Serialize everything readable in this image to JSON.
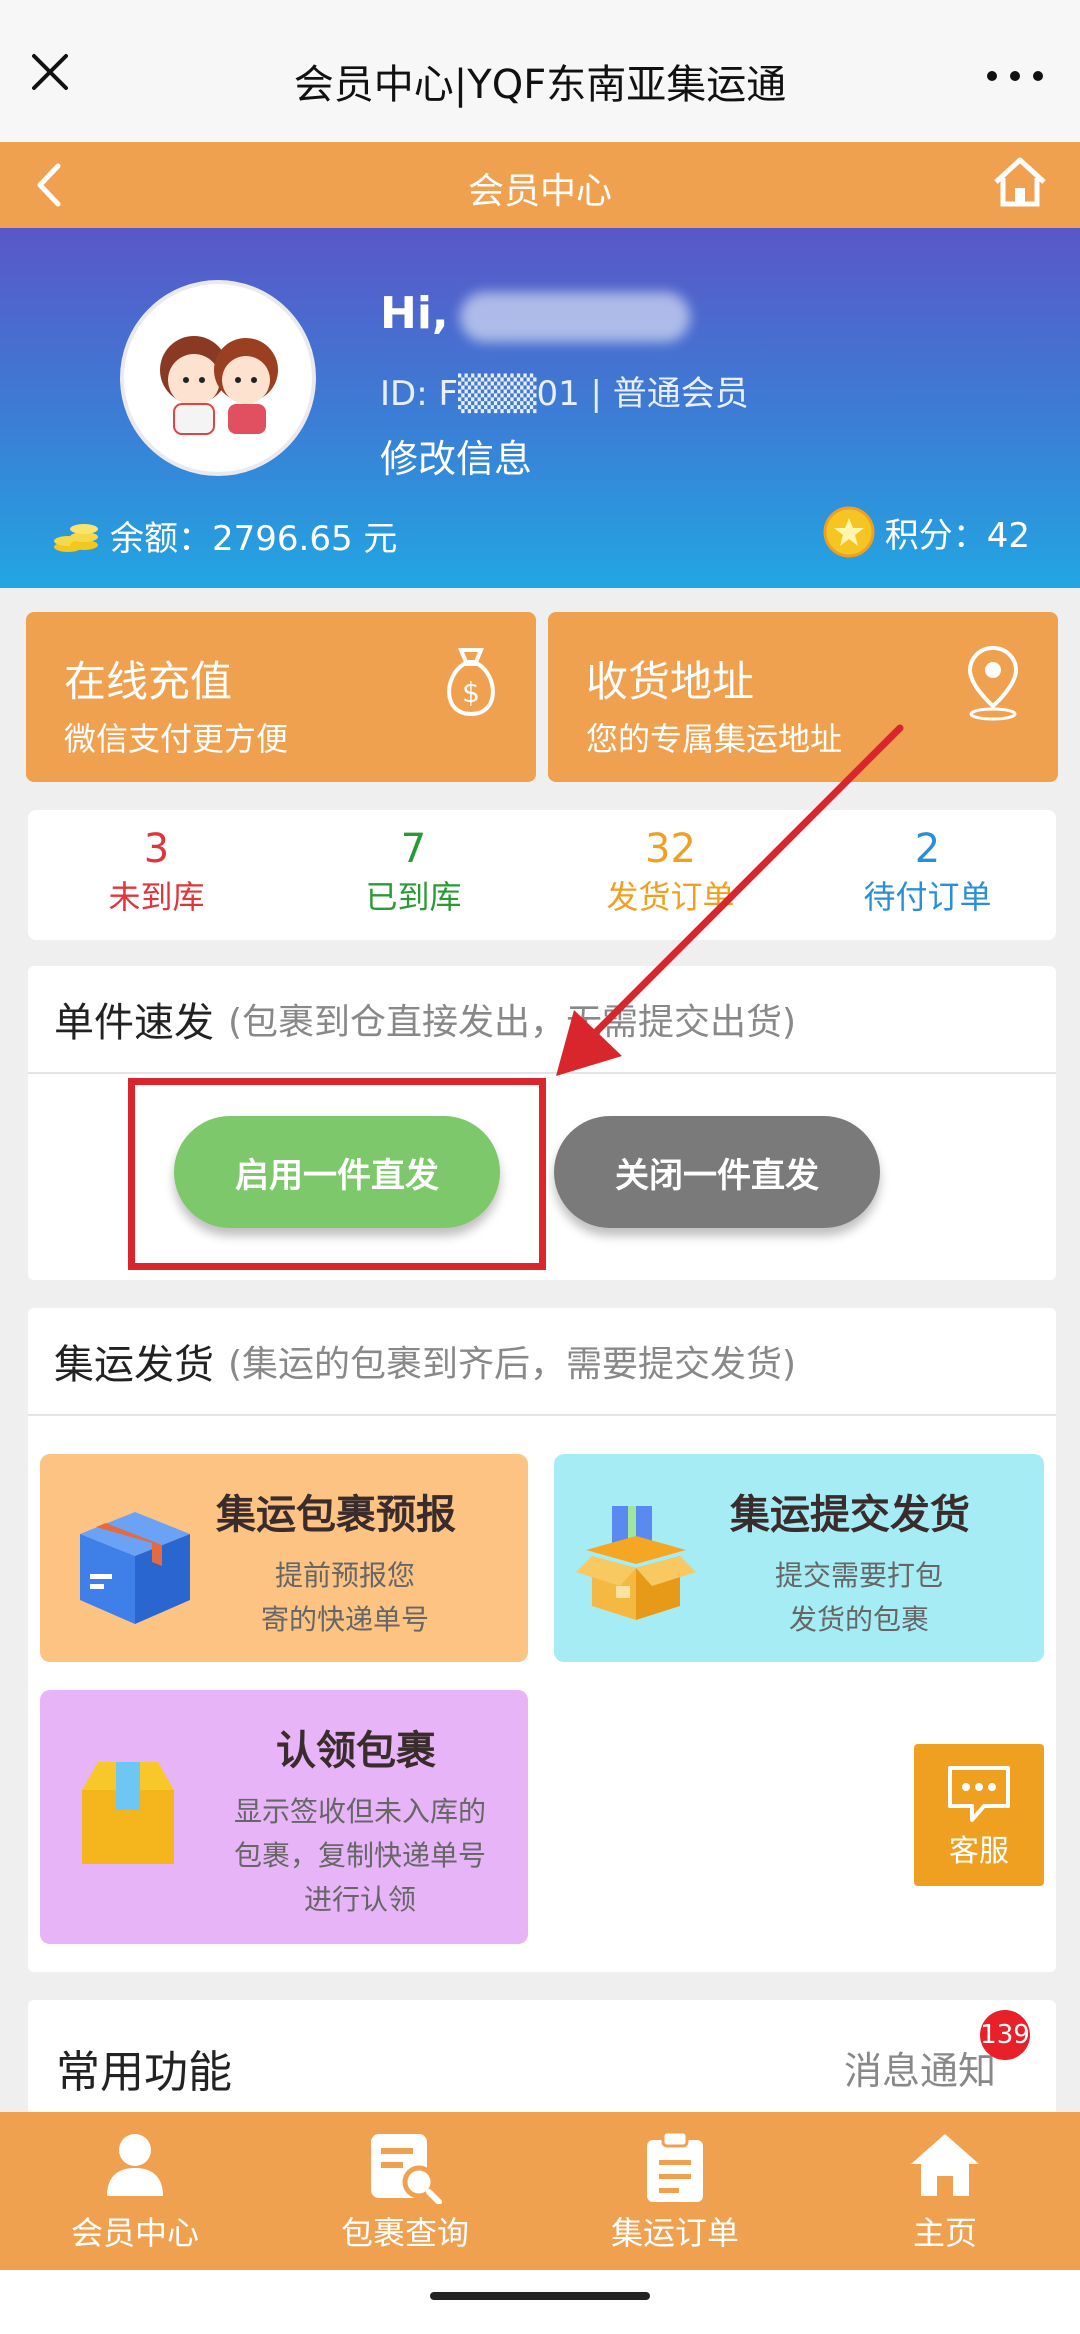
{
  "topbar": {
    "title": "会员中心|YQF东南亚集运通"
  },
  "header": {
    "title": "会员中心"
  },
  "profile": {
    "greeting": "Hi,",
    "id_line": "ID: F▒▒▒01 | 普通会员",
    "edit": "修改信息",
    "balance": "余额：2796.65 元",
    "points": "积分：42"
  },
  "cards": [
    {
      "title": "在线充值",
      "sub": "微信支付更方便",
      "icon": "money-bag-icon"
    },
    {
      "title": "收货地址",
      "sub": "您的专属集运地址",
      "icon": "location-pin-icon"
    }
  ],
  "stats": [
    {
      "num": "3",
      "label": "未到库",
      "color": "#e0353b"
    },
    {
      "num": "7",
      "label": "已到库",
      "color": "#2a9a36"
    },
    {
      "num": "32",
      "label": "发货订单",
      "color": "#f0a020"
    },
    {
      "num": "2",
      "label": "待付订单",
      "color": "#2b8fd8"
    }
  ],
  "single": {
    "title": "单件速发",
    "sub": "(包裹到仓直接发出，无需提交出货)",
    "enable": "启用一件直发",
    "disable": "关闭一件直发"
  },
  "consol": {
    "title": "集运发货",
    "sub": "(集运的包裹到齐后，需要提交发货)",
    "tiles": [
      {
        "title": "集运包裹预报",
        "desc1": "提前预报您",
        "desc2": "寄的快递单号",
        "desc3": ""
      },
      {
        "title": "集运提交发货",
        "desc1": "提交需要打包",
        "desc2": "发货的包裹",
        "desc3": ""
      },
      {
        "title": "认领包裹",
        "desc1": "显示签收但未入库的",
        "desc2": "包裹，复制快递单号",
        "desc3": "进行认领"
      }
    ],
    "kefu": "客服"
  },
  "common": {
    "title": "常用功能",
    "msg": "消息通知",
    "badge": "139"
  },
  "tabs": [
    {
      "label": "会员中心",
      "icon": "user-icon"
    },
    {
      "label": "包裹查询",
      "icon": "parcel-search-icon"
    },
    {
      "label": "集运订单",
      "icon": "clipboard-icon"
    },
    {
      "label": "主页",
      "icon": "home-icon"
    }
  ],
  "colors": {
    "orange": "#f0a150",
    "green": "#7dc86a",
    "gray": "#7a7a7a",
    "annotation_red": "#d8262c"
  }
}
